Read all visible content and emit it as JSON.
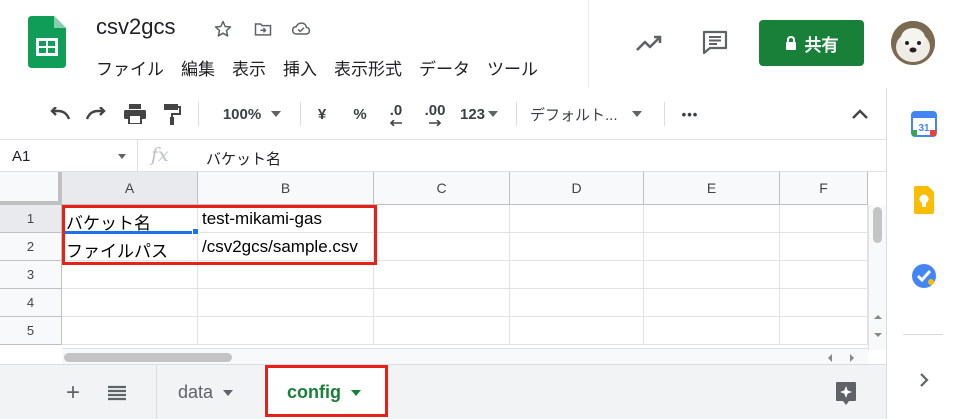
{
  "doc": {
    "title": "csv2gcs"
  },
  "menu": [
    "ファイル",
    "編集",
    "表示",
    "挿入",
    "表示形式",
    "データ",
    "ツール"
  ],
  "header": {
    "share_label": "共有"
  },
  "toolbar": {
    "zoom": "100%",
    "currency": "¥",
    "percent": "%",
    "dec_decrease": ".0",
    "dec_increase": ".00",
    "number_format": "123",
    "font": "デフォルト...",
    "more": "•••"
  },
  "formula": {
    "cell_ref": "A1",
    "fx": "fx",
    "content": "バケット名"
  },
  "grid": {
    "columns": [
      "A",
      "B",
      "C",
      "D",
      "E",
      "F"
    ],
    "rows": [
      "1",
      "2",
      "3",
      "4",
      "5"
    ],
    "cells": [
      [
        "バケット名",
        "test-mikami-gas"
      ],
      [
        "ファイルパス",
        "/csv2gcs/sample.csv"
      ]
    ]
  },
  "tabs": {
    "add": "+",
    "sheets": [
      "data",
      "config"
    ],
    "active": "config"
  },
  "colors": {
    "accent_green": "#188038",
    "highlight_red": "#e8201a",
    "selection_blue": "#1a73e8"
  },
  "icons": [
    "sheets-logo-icon",
    "star-icon",
    "move-folder-icon",
    "cloud-saved-icon",
    "activity-trend-icon",
    "comment-icon",
    "lock-icon",
    "undo-icon",
    "redo-icon",
    "print-icon",
    "paint-format-icon",
    "collapse-chevron-icon",
    "calendar-icon",
    "keep-icon",
    "tasks-icon",
    "expand-panel-icon",
    "explore-icon"
  ]
}
